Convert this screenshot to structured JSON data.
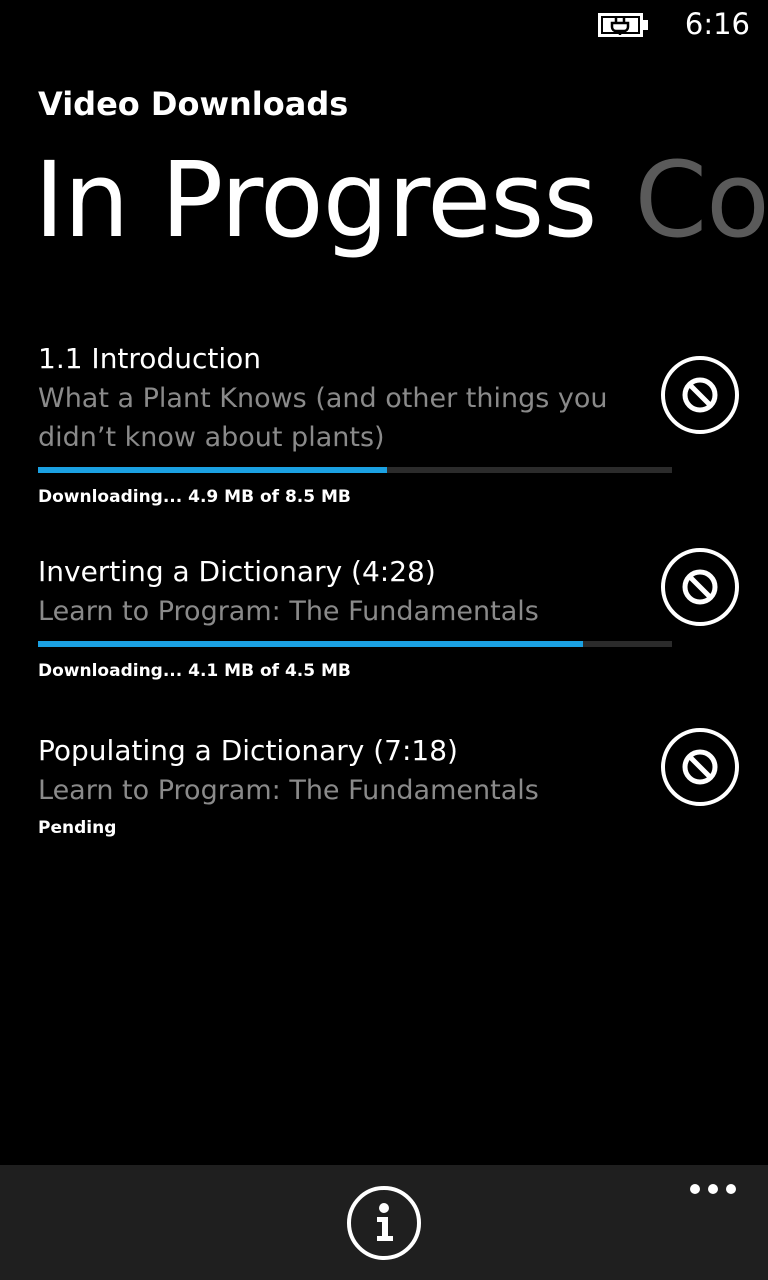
{
  "status_bar": {
    "time": "6:16",
    "battery_icon": "battery-charging-icon"
  },
  "header": {
    "app_title": "Video Downloads",
    "pivots": [
      {
        "label": "In Progress",
        "active": true
      },
      {
        "label": "Completed",
        "active": false,
        "visible_text": "Co"
      }
    ]
  },
  "colors": {
    "accent": "#1ba1e2",
    "subtle_text": "#8a8a8a",
    "app_bar": "#1f1f1f"
  },
  "downloads": [
    {
      "title": "1.1 Introduction",
      "subtitle": "What a Plant Knows (and other things you didn’t know about plants)",
      "progress": 0.55,
      "status": "Downloading... 4.9 MB of 8.5 MB",
      "action_icon": "cancel-icon"
    },
    {
      "title": "Inverting a Dictionary (4:28)",
      "subtitle": "Learn to Program: The Fundamentals",
      "progress": 0.86,
      "status": "Downloading... 4.1 MB of 4.5 MB",
      "action_icon": "cancel-icon"
    },
    {
      "title": "Populating a Dictionary (7:18)",
      "subtitle": "Learn to Program: The Fundamentals",
      "progress": null,
      "status": "Pending",
      "action_icon": "cancel-icon"
    }
  ],
  "app_bar": {
    "primary_icon": "info-icon",
    "more_icon": "more-dots-icon"
  }
}
